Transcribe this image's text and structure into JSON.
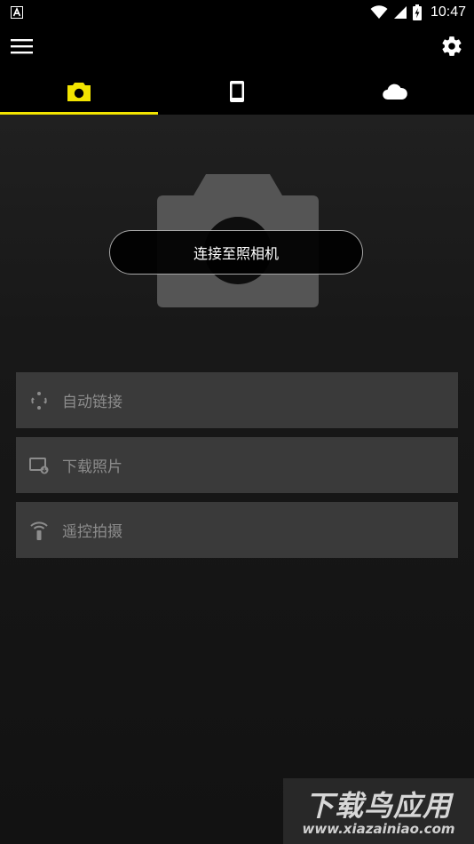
{
  "status_bar": {
    "time": "10:47",
    "left_icon": "a-notification-icon",
    "icons": [
      "wifi-icon",
      "signal-icon",
      "battery-charging-icon"
    ]
  },
  "toolbar": {
    "menu_icon": "hamburger-menu-icon",
    "settings_icon": "gear-icon"
  },
  "tabs": [
    {
      "icon": "camera-icon",
      "active": true
    },
    {
      "icon": "phone-icon",
      "active": false
    },
    {
      "icon": "cloud-icon",
      "active": false
    }
  ],
  "colors": {
    "accent": "#f2e400",
    "background": "#111111",
    "bar": "#000000",
    "item_bg": "#3a3a3a",
    "item_text": "#8c8c8c"
  },
  "main": {
    "connect_label": "连接至照相机"
  },
  "features": [
    {
      "icon": "auto-link-icon",
      "label": "自动链接"
    },
    {
      "icon": "download-photo-icon",
      "label": "下载照片"
    },
    {
      "icon": "remote-shoot-icon",
      "label": "遥控拍摄"
    }
  ],
  "watermark": {
    "title": "下载鸟应用",
    "url": "www.xiazainiao.com"
  }
}
